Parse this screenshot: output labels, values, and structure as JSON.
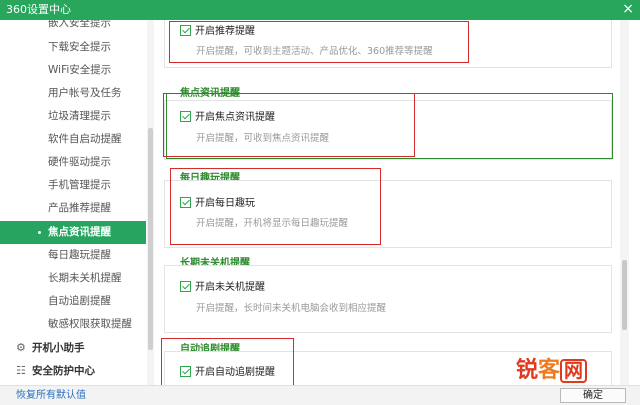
{
  "window": {
    "title": "360设置中心",
    "close_glyph": "×"
  },
  "sidebar": {
    "items": [
      {
        "label": "嵌入安全提示"
      },
      {
        "label": "下载安全提示"
      },
      {
        "label": "WiFi安全提示"
      },
      {
        "label": "用户帐号及任务"
      },
      {
        "label": "垃圾清理提示"
      },
      {
        "label": "软件自启动提醒"
      },
      {
        "label": "硬件驱动提示"
      },
      {
        "label": "手机管理提示"
      },
      {
        "label": "产品推荐提醒"
      },
      {
        "label": "焦点资讯提醒",
        "active": true
      },
      {
        "label": "每日趣玩提醒"
      },
      {
        "label": "长期未关机提醒"
      },
      {
        "label": "自动追剧提醒"
      },
      {
        "label": "敏感权限获取提醒"
      }
    ],
    "groups": [
      {
        "label": "开机小助手",
        "icon": "gear-icon",
        "glyph": "⚙"
      },
      {
        "label": "安全防护中心",
        "icon": "grid-icon",
        "glyph": "☷"
      }
    ]
  },
  "main": {
    "sections": [
      {
        "title": "",
        "checkbox_label": "开启推荐提醒",
        "checked": true,
        "description": "开启提醒，可收到主题活动、产品优化、360推荐等提醒"
      },
      {
        "title": "焦点资讯提醒",
        "checkbox_label": "开启焦点资讯提醒",
        "checked": true,
        "description": "开启提醒，可收到焦点资讯提醒"
      },
      {
        "title": "每日趣玩提醒",
        "checkbox_label": "开启每日趣玩",
        "checked": true,
        "description": "开启提醒，开机将显示每日趣玩提醒"
      },
      {
        "title": "长期未关机提醒",
        "checkbox_label": "开启未关机提醒",
        "checked": true,
        "description": "开启提醒，长时间未关机电脑会收到相应提醒"
      },
      {
        "title": "自动追剧提醒",
        "checkbox_label": "开启自动追剧提醒",
        "checked": true,
        "description": ""
      }
    ]
  },
  "footer": {
    "restore_label": "恢复所有默认值",
    "confirm_label": "确定"
  },
  "watermark": {
    "part_a": "锐",
    "part_b": "客",
    "part_c": "网"
  },
  "colors": {
    "titlebar": "#27a65c",
    "accent": "#26a460",
    "section_title": "#2e8b2e",
    "annotation": "#d62b2b",
    "link": "#2a6fc0"
  }
}
